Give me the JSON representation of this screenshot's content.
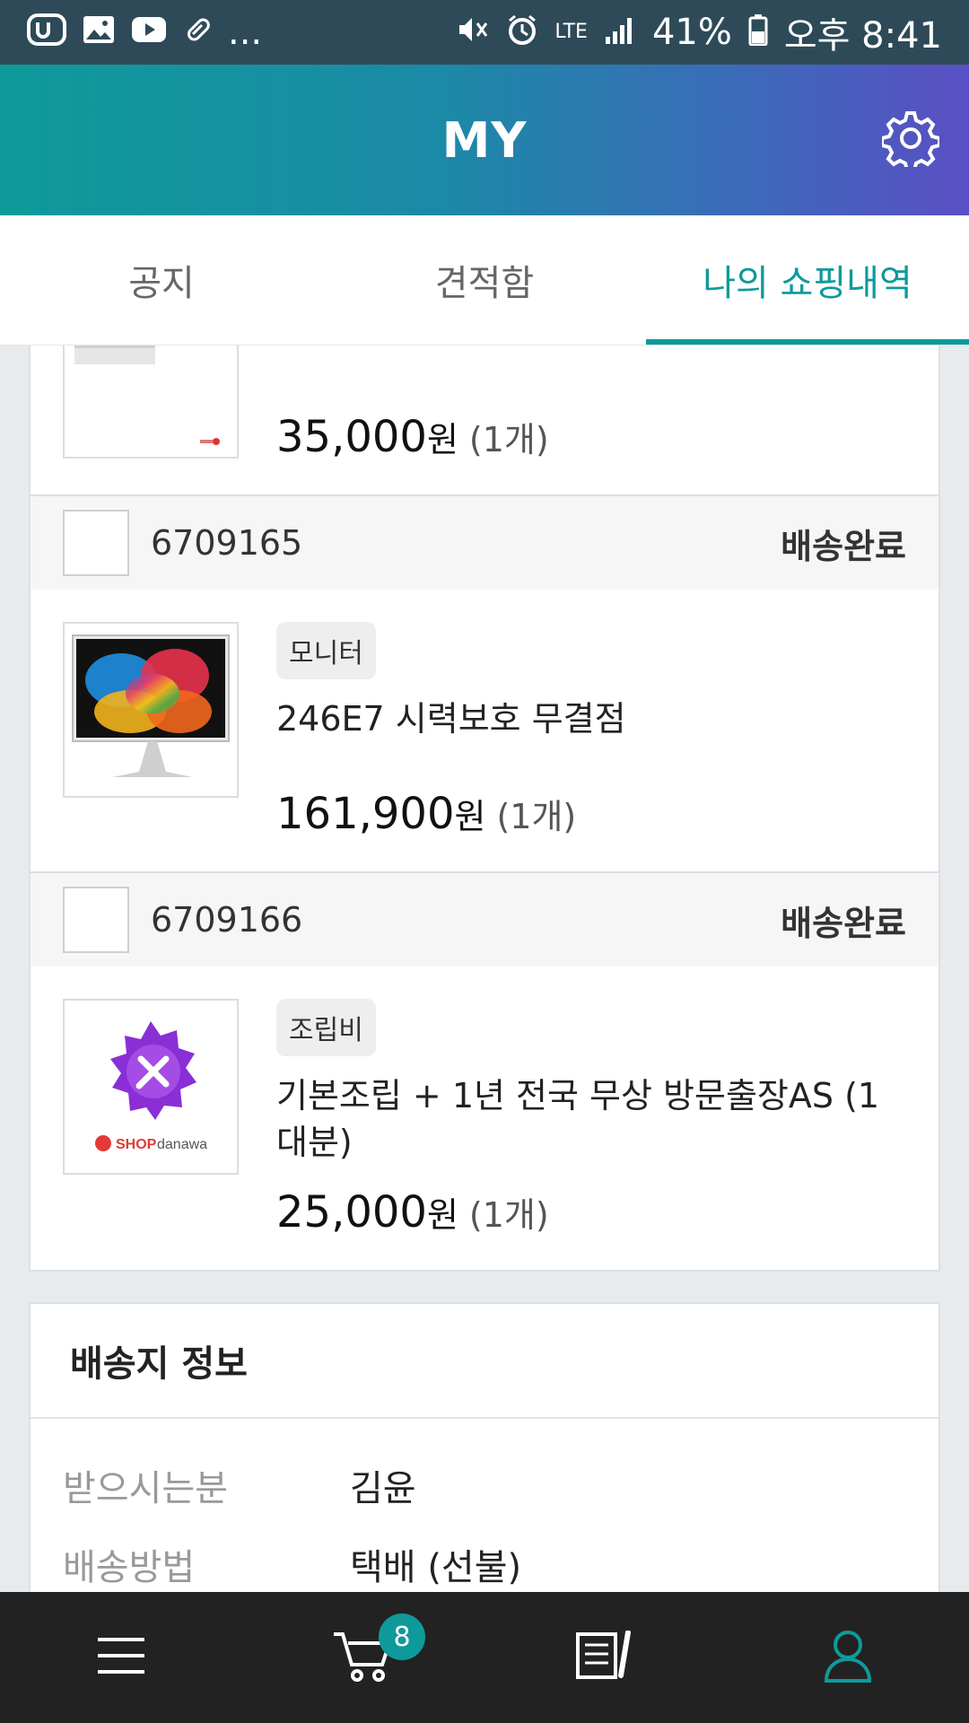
{
  "status_bar": {
    "left_more": "...",
    "network": "LTE",
    "battery": "41%",
    "time": "오후 8:41"
  },
  "header": {
    "title": "MY",
    "settings_icon": "gear-icon"
  },
  "tabs": [
    {
      "label": "공지",
      "active": false
    },
    {
      "label": "견적함",
      "active": false
    },
    {
      "label": "나의 쇼핑내역",
      "active": true
    }
  ],
  "orders": [
    {
      "order_no": "",
      "status": "",
      "item": {
        "category": "",
        "name": "",
        "price": "35,000",
        "currency": "원",
        "qty": "(1개)"
      }
    },
    {
      "order_no": "6709165",
      "status": "배송완료",
      "item": {
        "category": "모니터",
        "name": "246E7 시력보호 무결점",
        "price": "161,900",
        "currency": "원",
        "qty": "(1개)"
      }
    },
    {
      "order_no": "6709166",
      "status": "배송완료",
      "item": {
        "category": "조립비",
        "name": "기본조립 + 1년 전국 무상 방문출장AS (1대분)",
        "price": "25,000",
        "currency": "원",
        "qty": "(1개)",
        "logo_text": "SHOPdanawa"
      }
    }
  ],
  "shipping": {
    "title": "배송지 정보",
    "rows": [
      {
        "label": "받으시는분",
        "value": "김윤"
      },
      {
        "label": "배송방법",
        "value": "택배 (선불)"
      }
    ]
  },
  "bottom_nav": {
    "cart_count": "8",
    "items": [
      "menu-icon",
      "cart-icon",
      "notes-icon",
      "user-icon"
    ]
  },
  "colors": {
    "accent": "#0e9a9a",
    "header_gradient_end": "#5a4fc4",
    "nav_bg": "#222222"
  }
}
